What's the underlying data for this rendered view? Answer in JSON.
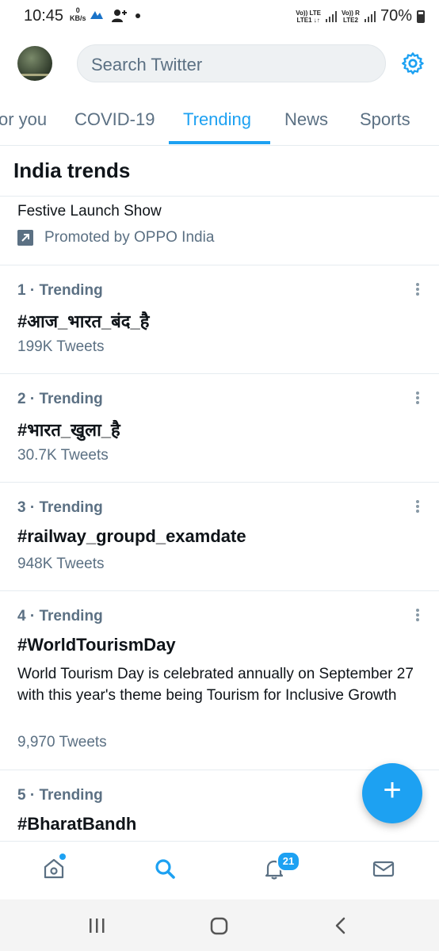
{
  "status_bar": {
    "time": "10:45",
    "speed_value": "0",
    "speed_unit": "KB/s",
    "sim1": "Vo)) LTE\nLTE1 ↓↑",
    "sim2": "Vo)) R\nLTE2",
    "battery": "70%"
  },
  "search": {
    "placeholder": "Search Twitter"
  },
  "tabs": [
    {
      "label": "or you"
    },
    {
      "label": "COVID-19"
    },
    {
      "label": "Trending",
      "active": true
    },
    {
      "label": "News"
    },
    {
      "label": "Sports"
    }
  ],
  "section_title": "India trends",
  "promoted": {
    "title": "Festive Launch Show",
    "by": "Promoted by OPPO India"
  },
  "trends": [
    {
      "meta": "1 · Trending",
      "name": "#आज_भारत_बंद_है",
      "count": "199K Tweets"
    },
    {
      "meta": "2 · Trending",
      "name": "#भारत_खुला_है",
      "count": "30.7K Tweets"
    },
    {
      "meta": "3 · Trending",
      "name": "#railway_groupd_examdate",
      "count": "948K Tweets"
    },
    {
      "meta": "4 · Trending",
      "name": "#WorldTourismDay",
      "description": "World Tourism Day is celebrated annually on September 27 with this year's theme being Tourism for Inclusive Growth",
      "count": "9,970 Tweets"
    },
    {
      "meta": "5 · Trending",
      "name": "#BharatBandh"
    }
  ],
  "fab": {
    "label": "+"
  },
  "notifications_badge": "21",
  "colors": {
    "accent": "#1da1f2",
    "secondary_text": "#5b7083",
    "primary_text": "#0f1419"
  },
  "icons": [
    "home-icon",
    "search-icon",
    "bell-icon",
    "mail-icon",
    "gear-icon",
    "more-vertical-icon",
    "recents-icon",
    "home-circle-icon",
    "back-icon"
  ]
}
